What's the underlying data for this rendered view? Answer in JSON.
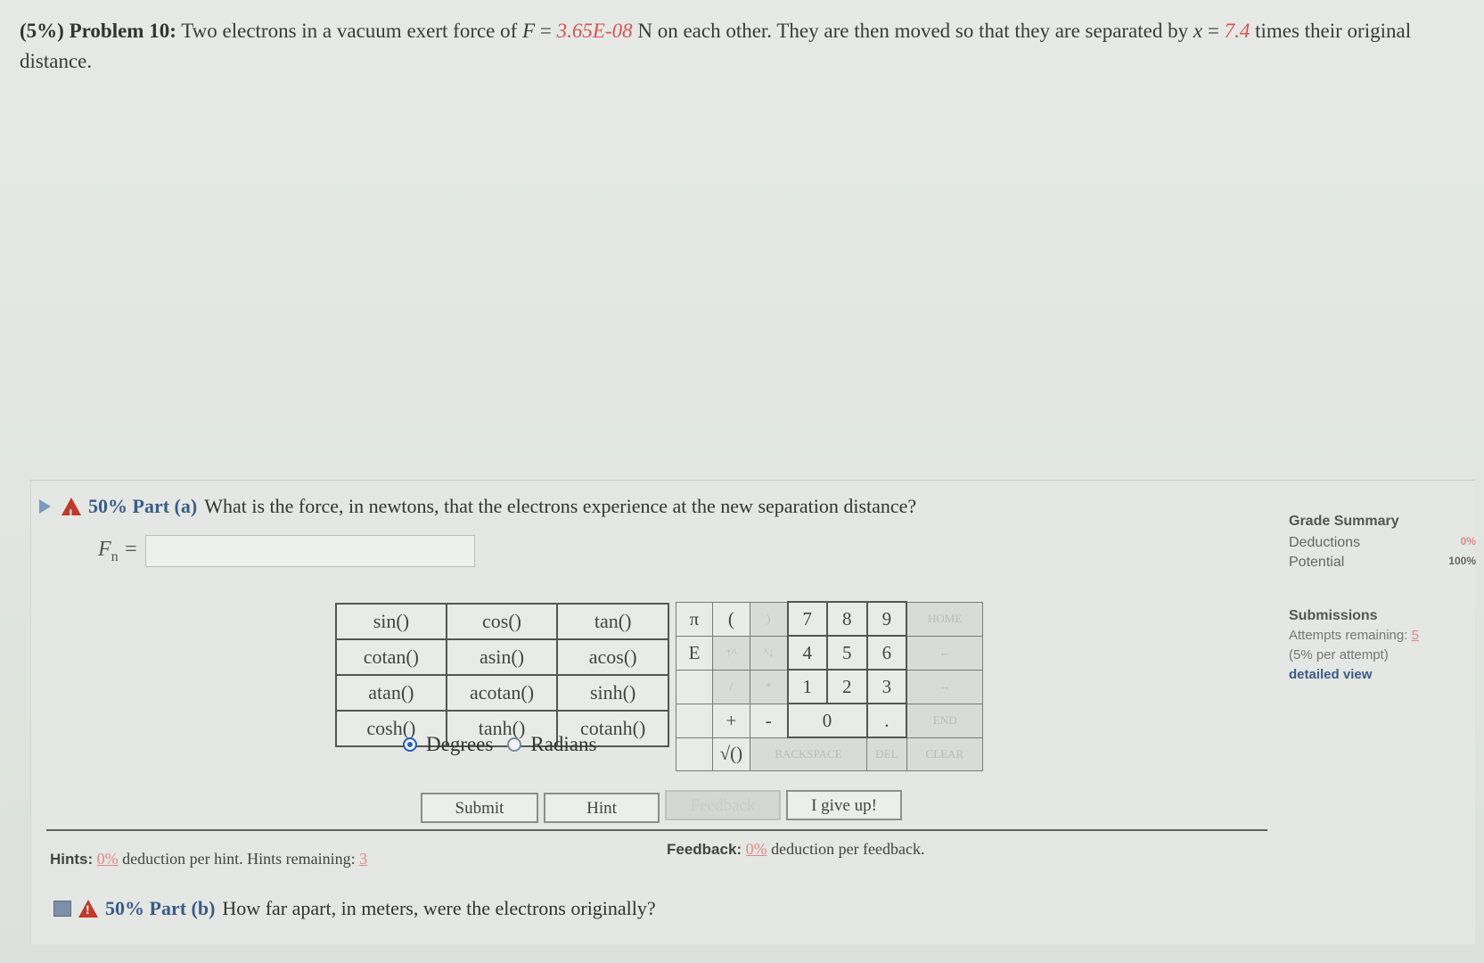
{
  "problem": {
    "prefix": "(5%) Problem 10:",
    "text_before_f": "Two electrons in a vacuum exert force of",
    "f_var": "F",
    "f_equals": " = ",
    "f_value": "3.65E-08",
    "f_unit_text": " N on each other. They are then moved so that they are separated by",
    "x_var": "x",
    "x_equals": " = ",
    "x_value": "7.4",
    "x_after": " times their original distance."
  },
  "part_a": {
    "percent": "50% Part (a)",
    "question": "What is the force, in newtons, that the electrons experience at the new separation distance?",
    "answer_label": "F",
    "answer_sub": "n",
    "answer_equals": " =",
    "answer_value": ""
  },
  "function_grid": [
    [
      "sin()",
      "cos()",
      "tan()"
    ],
    [
      "cotan()",
      "asin()",
      "acos()"
    ],
    [
      "atan()",
      "acotan()",
      "sinh()"
    ],
    [
      "cosh()",
      "tanh()",
      "cotanh()"
    ]
  ],
  "angle_mode": {
    "degrees": "Degrees",
    "radians": "Radians",
    "selected": "Degrees"
  },
  "keypad": {
    "row1": [
      "π",
      "(",
      ")",
      "7",
      "8",
      "9",
      "HOME"
    ],
    "row2": [
      "E",
      "↑^",
      "^↓",
      "4",
      "5",
      "6",
      "←"
    ],
    "row3": [
      "",
      "/",
      "*",
      "1",
      "2",
      "3",
      "→"
    ],
    "row4": [
      "",
      "+",
      "-",
      "0",
      ".",
      "END"
    ],
    "row5": [
      "",
      "√()",
      "BACKSPACE",
      "DEL",
      "CLEAR"
    ]
  },
  "buttons": {
    "submit": "Submit",
    "hint": "Hint",
    "feedback": "Feedback",
    "give_up": "I give up!"
  },
  "hints": {
    "label": "Hints:",
    "pct": "0%",
    "text": "deduction per hint. Hints remaining:",
    "remaining": "3"
  },
  "feedback": {
    "label": "Feedback:",
    "pct": "0%",
    "text": "deduction per feedback."
  },
  "part_b": {
    "percent": "50% Part (b)",
    "question": "How far apart, in meters, were the electrons originally?"
  },
  "grade_summary": {
    "title": "Grade Summary",
    "deductions_label": "Deductions",
    "deductions_value": "0%",
    "potential_label": "Potential",
    "potential_value": "100%"
  },
  "submissions": {
    "title": "Submissions",
    "attempts_label": "Attempts remaining:",
    "attempts_value": "5",
    "per_attempt": "(5% per attempt)",
    "detailed_view": "detailed view"
  }
}
